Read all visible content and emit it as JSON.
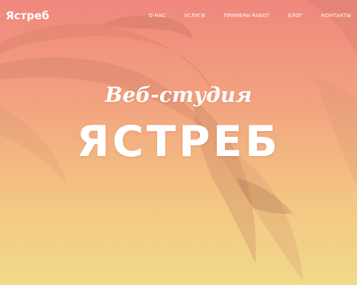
{
  "brand": {
    "logo_text": "Ястреб"
  },
  "nav": {
    "items": [
      {
        "label": "О НАС"
      },
      {
        "label": "УСЛУГИ"
      },
      {
        "label": "ПРИМЕРЫ РАБОТ"
      },
      {
        "label": "БЛОГ"
      },
      {
        "label": "КОНТАКТЫ"
      }
    ]
  },
  "hero": {
    "subtitle": "Веб-студия",
    "title": "ЯСТРЕБ",
    "background_image": "hawk-in-flight",
    "gradient_colors": [
      "#f0877e",
      "#f2a27f",
      "#f3c683",
      "#f2d98a"
    ]
  }
}
